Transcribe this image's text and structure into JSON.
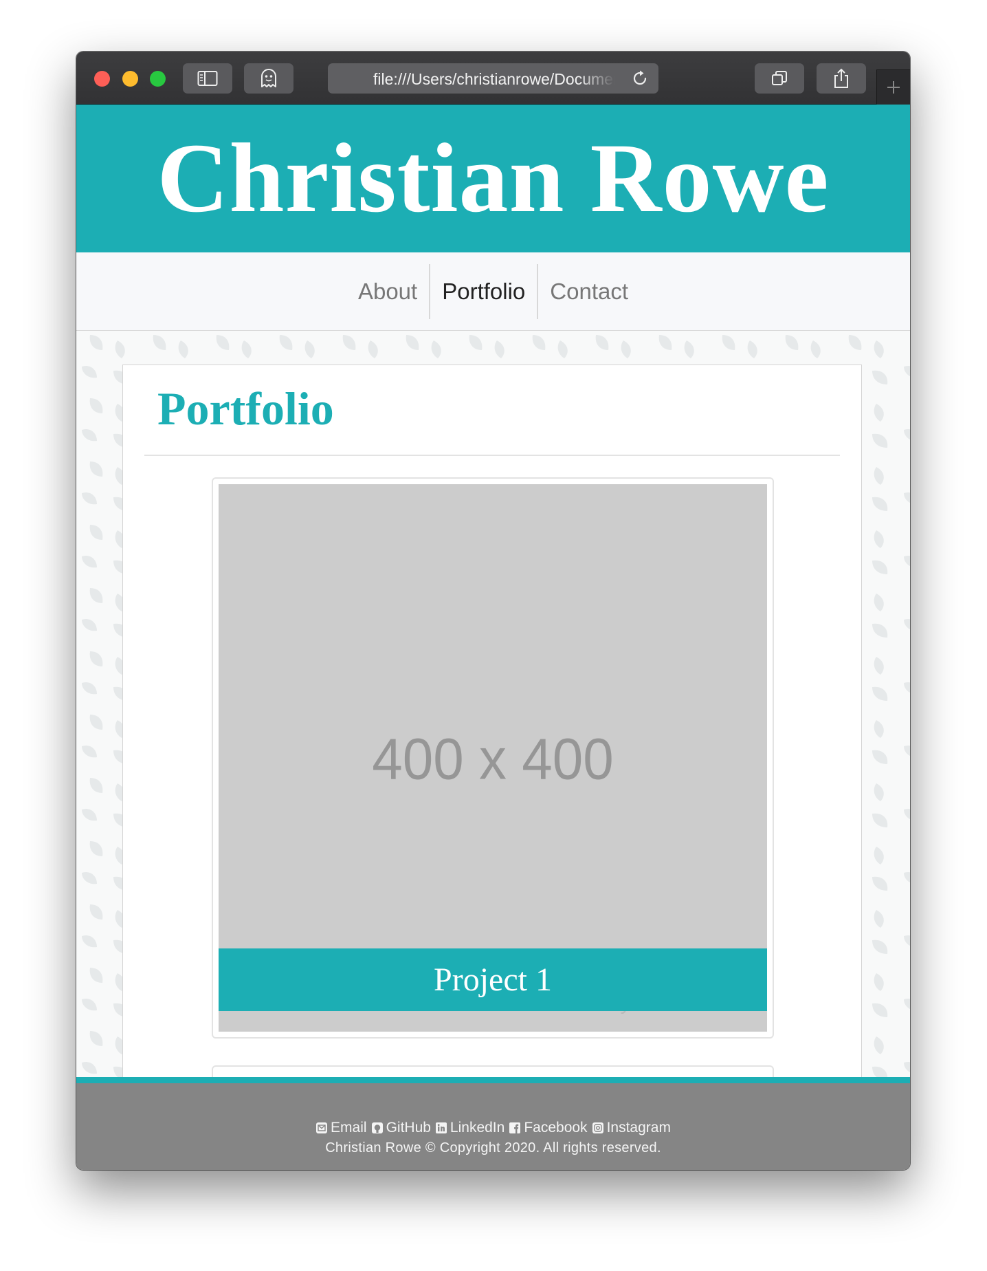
{
  "browser": {
    "address": "file:///Users/christianrowe/Documents/portfolio/portfolio.html"
  },
  "hero": {
    "title": "Christian Rowe"
  },
  "nav": {
    "items": [
      {
        "label": "About"
      },
      {
        "label": "Portfolio"
      },
      {
        "label": "Contact"
      }
    ],
    "active": "Portfolio"
  },
  "section": {
    "heading": "Portfolio"
  },
  "projects": [
    {
      "placeholder": "400 x 400",
      "watermark": "Powered by HTML.COM",
      "caption": "Project 1"
    }
  ],
  "footer": {
    "links": [
      {
        "label": "Email",
        "icon": "envelope-icon"
      },
      {
        "label": "GitHub",
        "icon": "github-icon"
      },
      {
        "label": "LinkedIn",
        "icon": "linkedin-icon"
      },
      {
        "label": "Facebook",
        "icon": "facebook-icon"
      },
      {
        "label": "Instagram",
        "icon": "instagram-icon"
      }
    ],
    "copyright": "Christian Rowe © Copyright 2020. All rights reserved."
  },
  "colors": {
    "accent": "#1caeb4",
    "footer": "#858585",
    "placeholder": "#cccccc"
  }
}
